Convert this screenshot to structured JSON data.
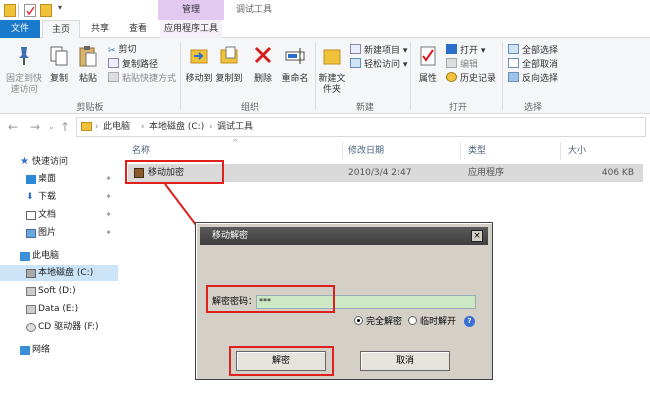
{
  "titlebar": {
    "context_tab": "管理",
    "title": "调试工具"
  },
  "tabs": {
    "file": "文件",
    "home": "主页",
    "share": "共享",
    "view": "查看",
    "app_tools": "应用程序工具"
  },
  "ribbon": {
    "clipboard": {
      "pin": "固定到快速访问",
      "copy": "复制",
      "paste": "粘贴",
      "cut": "剪切",
      "copy_path": "复制路径",
      "paste_shortcut": "粘贴快捷方式",
      "label": "剪贴板"
    },
    "organize": {
      "move_to": "移动到",
      "copy_to": "复制到",
      "delete": "删除",
      "rename": "重命名",
      "label": "组织"
    },
    "new": {
      "new_folder": "新建文件夹",
      "new_item": "新建项目",
      "easy_access": "轻松访问",
      "label": "新建"
    },
    "open": {
      "properties": "属性",
      "open": "打开",
      "edit": "编辑",
      "history": "历史记录",
      "label": "打开"
    },
    "select": {
      "select_all": "全部选择",
      "select_none": "全部取消",
      "invert": "反向选择",
      "label": "选择"
    }
  },
  "address": {
    "crumbs": [
      "此电脑",
      "本地磁盘 (C:)",
      "调试工具"
    ]
  },
  "nav": {
    "quick_access": "快速访问",
    "desktop": "桌面",
    "downloads": "下载",
    "documents": "文档",
    "pictures": "图片",
    "this_pc": "此电脑",
    "drive_c": "本地磁盘 (C:)",
    "drive_d": "Soft (D:)",
    "drive_e": "Data (E:)",
    "drive_f": "CD 驱动器 (F:)",
    "network": "网络"
  },
  "columns": {
    "name": "名称",
    "date": "修改日期",
    "type": "类型",
    "size": "大小"
  },
  "file": {
    "name": "移动加密",
    "date": "2010/3/4 2:47",
    "type": "应用程序",
    "size": "406 KB"
  },
  "dialog": {
    "title": "移动解密",
    "close": "×",
    "password_label": "解密密码：",
    "password_value": "***",
    "opt_full": "完全解密",
    "opt_temp": "临时解开",
    "help": "?",
    "decrypt": "解密",
    "cancel": "取消"
  },
  "colors": {
    "accent": "#1979ca",
    "annotation": "#e0201c",
    "input_bg": "#cde8c5"
  }
}
